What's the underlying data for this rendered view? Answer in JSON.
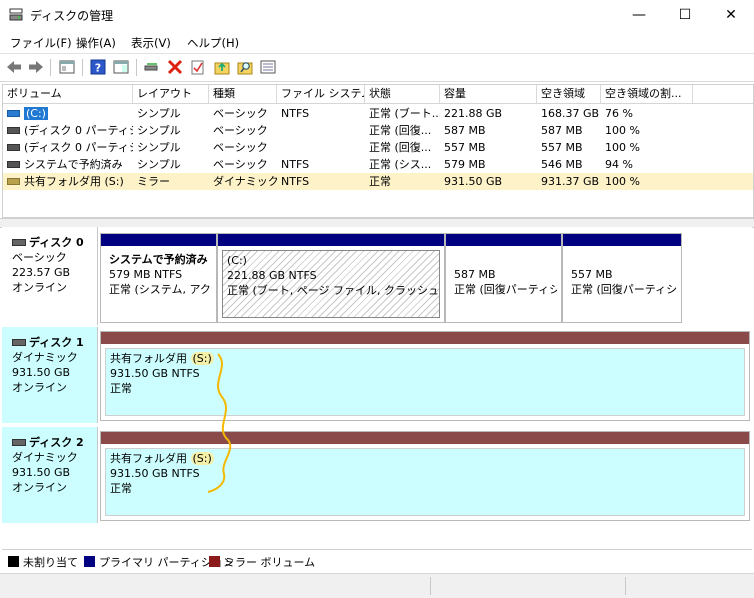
{
  "window": {
    "title": "ディスクの管理",
    "minimize": "—",
    "maximize": "☐",
    "close": "✕"
  },
  "menu": [
    "ファイル(F)",
    "操作(A)",
    "表示(V)",
    "ヘルプ(H)"
  ],
  "toolbar_icons": [
    "back-arrow-icon",
    "forward-arrow-icon",
    "console-tree-icon",
    "help-icon",
    "show-pane-icon",
    "connect-icon",
    "delete-icon",
    "properties-icon",
    "import-icon",
    "search-icon",
    "list-icon"
  ],
  "list": {
    "columns": [
      "ボリューム",
      "レイアウト",
      "種類",
      "ファイル システム",
      "状態",
      "容量",
      "空き領域",
      "空き領域の割..."
    ],
    "rows": [
      {
        "volume": "(C:)",
        "layout": "シンプル",
        "type": "ベーシック",
        "fs": "NTFS",
        "status": "正常 (ブート...",
        "capacity": "221.88 GB",
        "free": "168.37 GB",
        "pct": "76 %",
        "icon": "blue"
      },
      {
        "volume": "(ディスク 0 パーティシ...",
        "layout": "シンプル",
        "type": "ベーシック",
        "fs": "",
        "status": "正常 (回復...",
        "capacity": "587 MB",
        "free": "587 MB",
        "pct": "100 %",
        "icon": "gray"
      },
      {
        "volume": "(ディスク 0 パーティシ...",
        "layout": "シンプル",
        "type": "ベーシック",
        "fs": "",
        "status": "正常 (回復...",
        "capacity": "557 MB",
        "free": "557 MB",
        "pct": "100 %",
        "icon": "gray"
      },
      {
        "volume": "システムで予約済み",
        "layout": "シンプル",
        "type": "ベーシック",
        "fs": "NTFS",
        "status": "正常 (シス...",
        "capacity": "579 MB",
        "free": "546 MB",
        "pct": "94 %",
        "icon": "gray"
      },
      {
        "volume": "共有フォルダ用 (S:)",
        "layout": "ミラー",
        "type": "ダイナミック",
        "fs": "NTFS",
        "status": "正常",
        "capacity": "931.50 GB",
        "free": "931.37 GB",
        "pct": "100 %",
        "icon": "mirror"
      }
    ]
  },
  "disks": [
    {
      "name": "ディスク 0",
      "kind": "ベーシック",
      "size": "223.57 GB",
      "state": "オンライン",
      "partitions": [
        {
          "title": "システムで予約済み",
          "line2": "579 MB NTFS",
          "line3": "正常 (システム, アクテ"
        },
        {
          "title": "(C:)",
          "line2": "221.88 GB NTFS",
          "line3": "正常 (ブート, ページ ファイル, クラッシュ ダンプ,"
        },
        {
          "title": "",
          "line2": "587 MB",
          "line3": "正常 (回復パーティシ"
        },
        {
          "title": "",
          "line2": "557 MB",
          "line3": "正常 (回復パーティシ"
        }
      ]
    },
    {
      "name": "ディスク 1",
      "kind": "ダイナミック",
      "size": "931.50 GB",
      "state": "オンライン",
      "partitions": [
        {
          "title": "共有フォルダ用",
          "letter": "(S:)",
          "line2": "931.50 GB NTFS",
          "line3": "正常"
        }
      ]
    },
    {
      "name": "ディスク 2",
      "kind": "ダイナミック",
      "size": "931.50 GB",
      "state": "オンライン",
      "partitions": [
        {
          "title": "共有フォルダ用",
          "letter": "(S:)",
          "line2": "931.50 GB NTFS",
          "line3": "正常"
        }
      ]
    }
  ],
  "legend": [
    {
      "label": "未割り当て",
      "color": "#000000"
    },
    {
      "label": "プライマリ パーティション",
      "color": "#000080"
    },
    {
      "label": "ミラー ボリューム",
      "color": "#8b1a1a"
    }
  ],
  "colors": {
    "primary_bar": "#000080",
    "mirror_bar": "#8b4a4a",
    "selection": "#fdf2c8",
    "dynamic_bg": "#ccfeff",
    "annotation": "#f5b800"
  }
}
